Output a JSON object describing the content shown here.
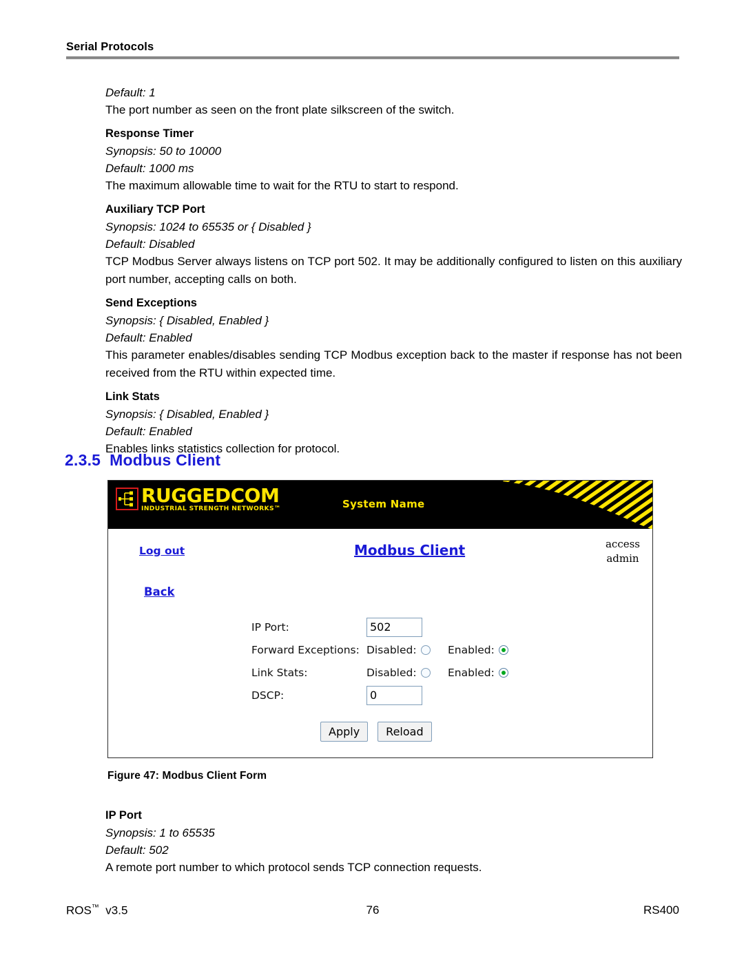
{
  "page": {
    "running_header": "Serial Protocols",
    "footer": {
      "left_product": "ROS",
      "left_tm": "™",
      "left_version": "v3.5",
      "page_number": "76",
      "right_model": "RS400"
    }
  },
  "body_upper": {
    "default_1": "Default: 1",
    "port_number_desc": "The port number as seen on the front plate silkscreen of the switch.",
    "response_timer": {
      "term": "Response Timer",
      "synopsis": "Synopsis: 50 to 10000",
      "default": "Default: 1000 ms",
      "description": "The maximum allowable time to wait for the RTU to start to respond."
    },
    "auxiliary_tcp_port": {
      "term": "Auxiliary TCP Port",
      "synopsis": "Synopsis: 1024 to 65535 or { Disabled }",
      "default": "Default: Disabled",
      "description": "TCP Modbus Server always listens on TCP port 502. It may be additionally configured to listen on this auxiliary port number, accepting calls on both."
    },
    "send_exceptions": {
      "term": "Send Exceptions",
      "synopsis": "Synopsis: { Disabled, Enabled }",
      "default": "Default: Enabled",
      "description": "This parameter enables/disables sending TCP Modbus exception back to the master if response has not been received from the RTU within expected time."
    },
    "link_stats": {
      "term": "Link Stats",
      "synopsis": "Synopsis: { Disabled, Enabled }",
      "default": "Default: Enabled",
      "description": "Enables links statistics collection for protocol."
    }
  },
  "section": {
    "number": "2.3.5",
    "title": "Modbus Client",
    "color": "#1a1ad6"
  },
  "figure": {
    "caption": "Figure 47: Modbus Client Form",
    "ui": {
      "brand": {
        "name": "RUGGEDCOM",
        "tagline": "INDUSTRIAL STRENGTH NETWORKS™",
        "logo_color": "#ffe500",
        "logo_border_color": "#d71b1b",
        "banner_color": "#000000"
      },
      "system_name": "System Name",
      "logout_label": "Log out",
      "page_title": "Modbus Client",
      "access_label": "access",
      "access_user": "admin",
      "back_label": "Back",
      "fields": [
        {
          "label": "IP Port:",
          "type": "text",
          "value": "502"
        },
        {
          "label": "Forward Exceptions:",
          "type": "radio",
          "options": [
            {
              "label": "Disabled:",
              "selected": false
            },
            {
              "label": "Enabled:",
              "selected": true
            }
          ]
        },
        {
          "label": "Link Stats:",
          "type": "radio",
          "options": [
            {
              "label": "Disabled:",
              "selected": false
            },
            {
              "label": "Enabled:",
              "selected": true
            }
          ]
        },
        {
          "label": "DSCP:",
          "type": "text",
          "value": "0"
        }
      ],
      "buttons": {
        "apply": "Apply",
        "reload": "Reload"
      },
      "link_color": "#1a1ad6",
      "selected_radio_color": "#00a81e"
    }
  },
  "body_lower": {
    "ip_port": {
      "term": "IP Port",
      "synopsis": "Synopsis: 1 to 65535",
      "default": "Default: 502",
      "description": "A remote port number to which protocol sends TCP connection requests."
    }
  }
}
